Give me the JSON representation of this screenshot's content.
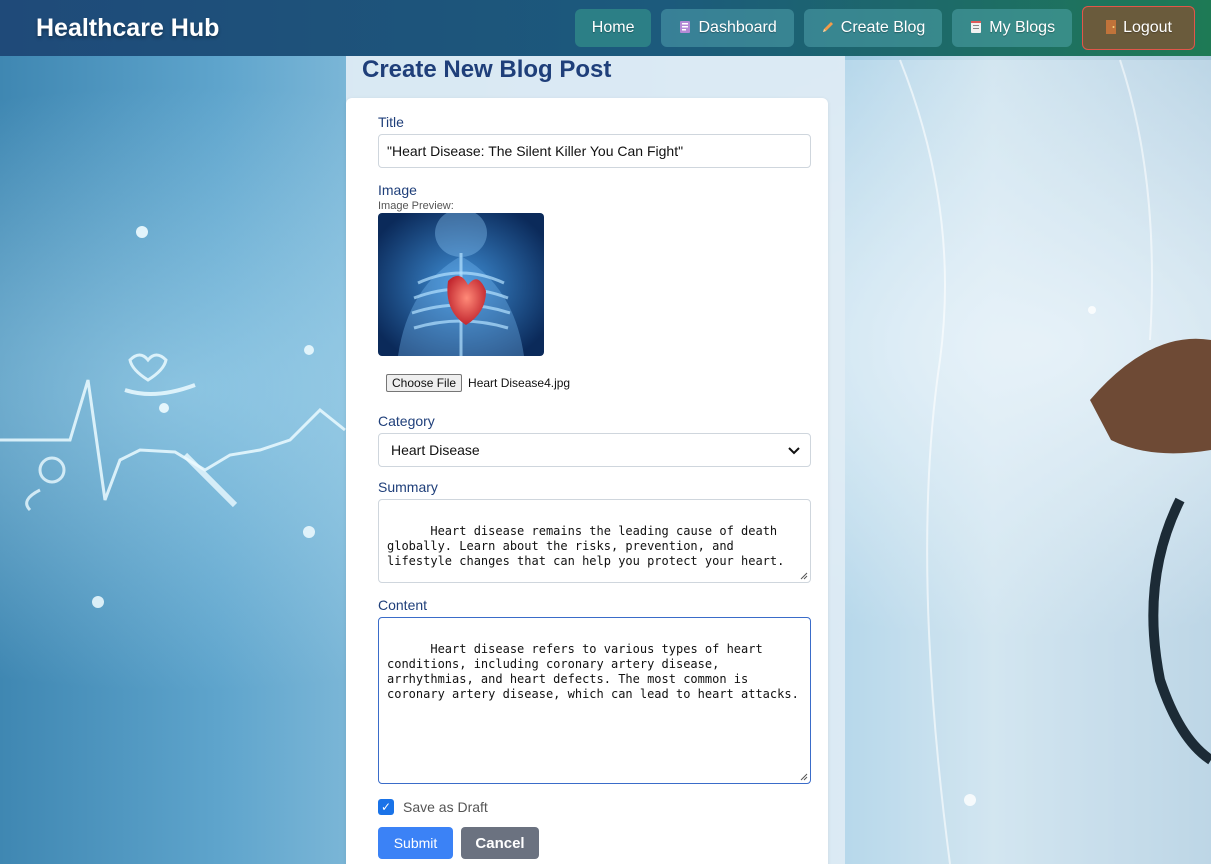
{
  "navbar": {
    "brand": "Healthcare Hub",
    "links": [
      {
        "label": "Home",
        "icon": "home"
      },
      {
        "label": "Dashboard",
        "icon": "dashboard-icon"
      },
      {
        "label": "Create Blog",
        "icon": "pencil-icon"
      },
      {
        "label": "My Blogs",
        "icon": "notepad-icon"
      },
      {
        "label": "Logout",
        "icon": "door-icon"
      }
    ]
  },
  "page": {
    "title": "Create New Blog Post"
  },
  "form": {
    "title_label": "Title",
    "title_value": "\"Heart Disease: The Silent Killer You Can Fight\"",
    "image_label": "Image",
    "image_preview_label": "Image Preview:",
    "file_button": "Choose File",
    "file_name": "Heart Disease4.jpg",
    "category_label": "Category",
    "category_value": "Heart Disease",
    "summary_label": "Summary",
    "summary_value": "Heart disease remains the leading cause of death globally. Learn about the risks, prevention, and lifestyle changes that can help you protect your heart.",
    "content_label": "Content",
    "content_value": "Heart disease refers to various types of heart conditions, including coronary artery disease, arrhythmias, and heart defects. The most common is coronary artery disease, which can lead to heart attacks.",
    "draft_label": "Save as Draft",
    "draft_checked": true,
    "submit_label": "Submit",
    "cancel_label": "Cancel"
  },
  "colors": {
    "accent": "#3b82f6",
    "label": "#1f3f7a",
    "cancel": "#6b7280"
  }
}
